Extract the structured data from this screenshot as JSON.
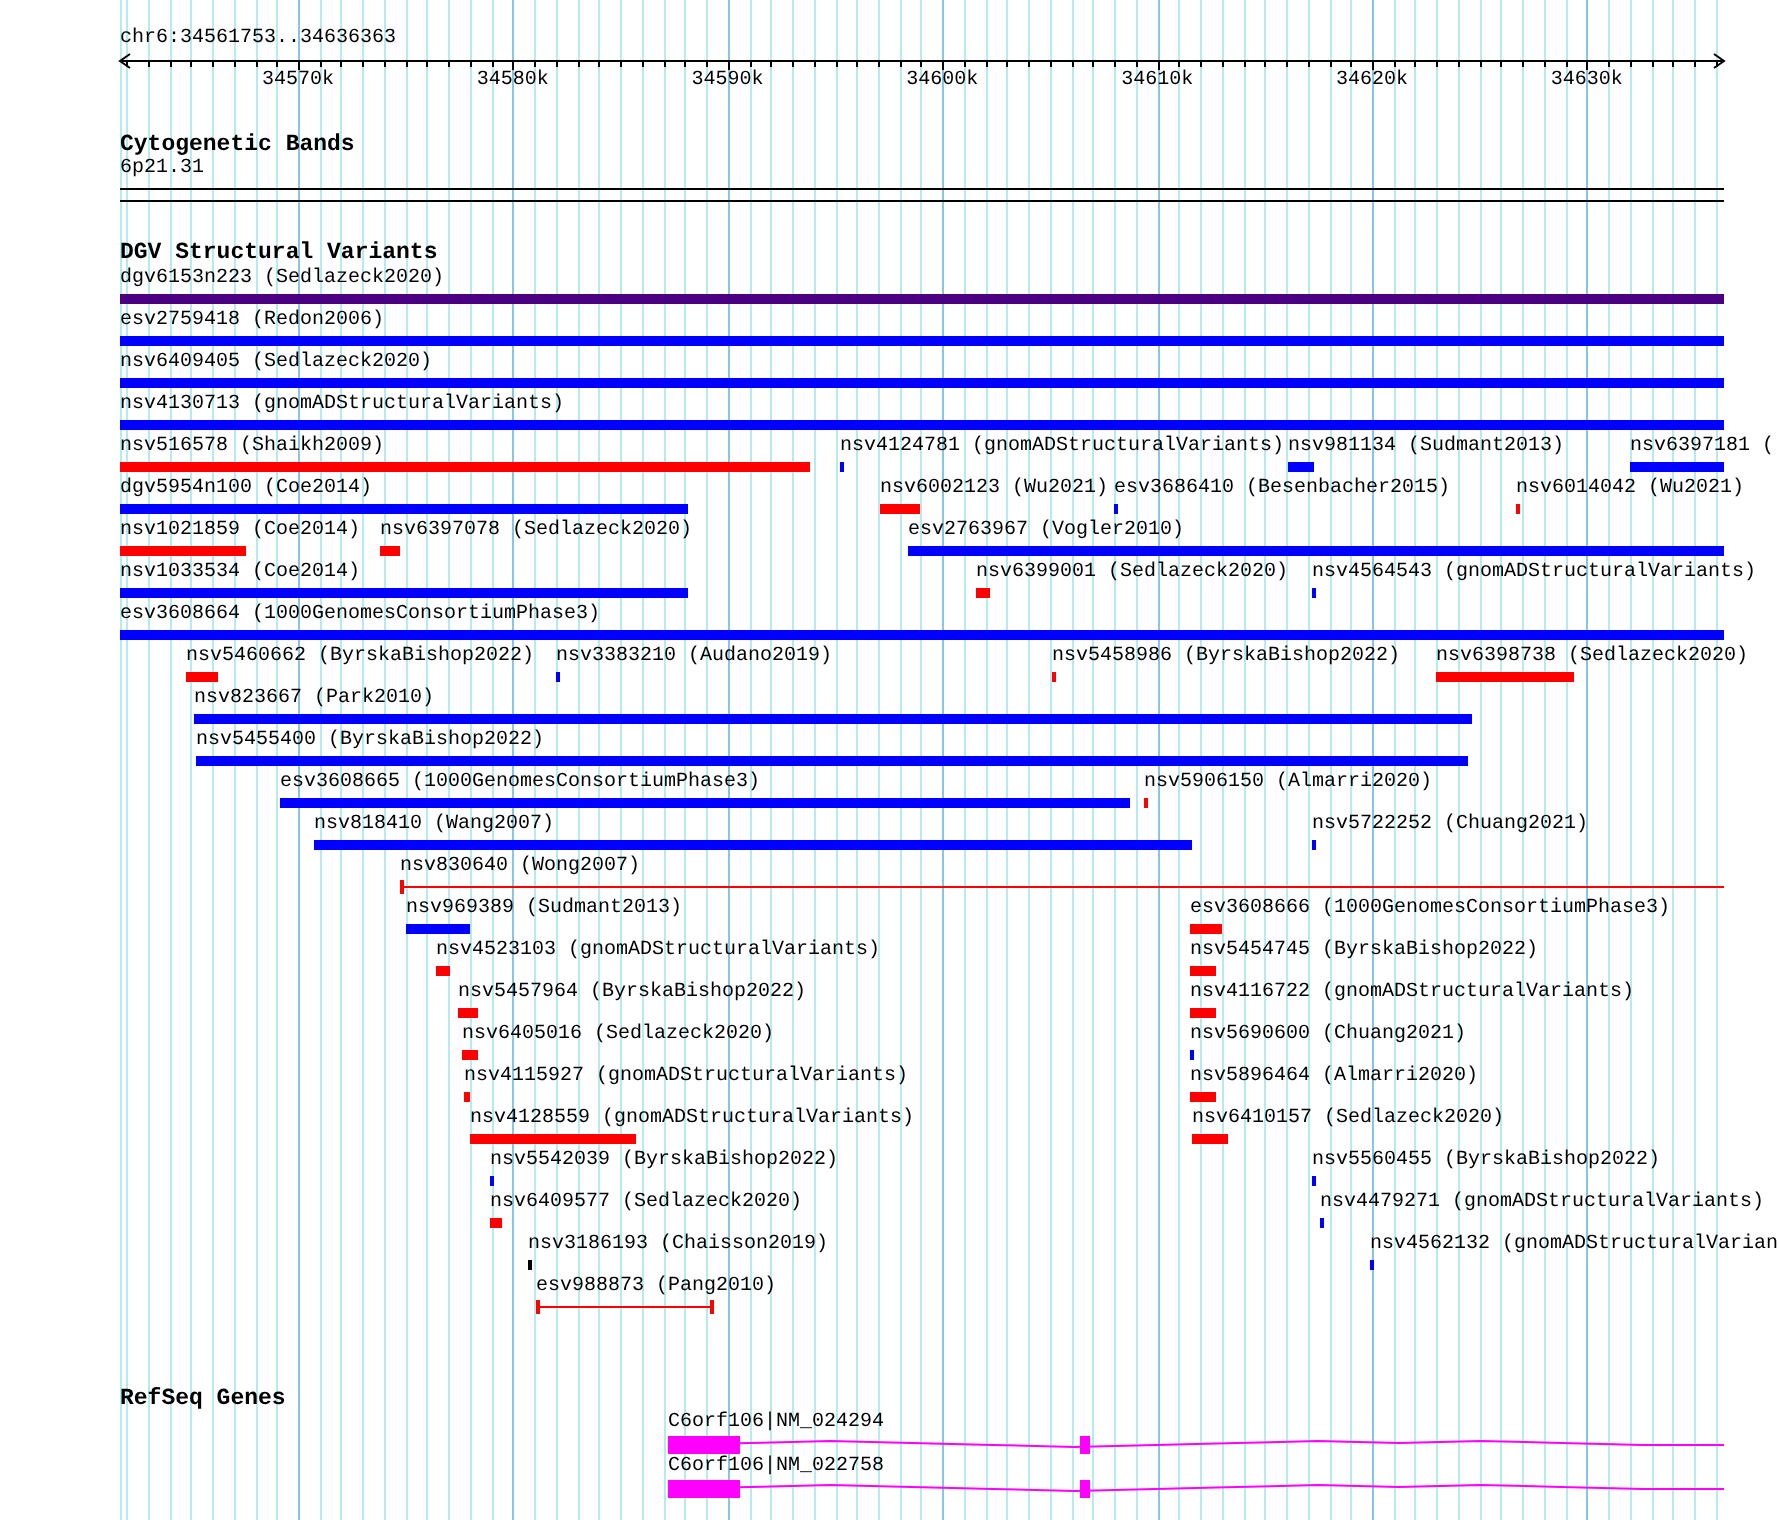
{
  "ruler": {
    "location": "chr6:34561753..34636363",
    "ticks": [
      {
        "label": "34570k"
      },
      {
        "label": "34580k"
      },
      {
        "label": "34590k"
      },
      {
        "label": "34600k"
      },
      {
        "label": "34610k"
      },
      {
        "label": "34620k"
      },
      {
        "label": "34630k"
      }
    ]
  },
  "cytogenetic_bands": {
    "title": "Cytogenetic Bands",
    "band": {
      "label": "6p21.31"
    }
  },
  "dgv_track": {
    "title": "DGV Structural Variants",
    "rows": [
      {
        "features": [
          {
            "label": "dgv6153n223 (Sedlazeck2020)",
            "color": "#4b0082",
            "kind": "bar"
          }
        ]
      },
      {
        "features": [
          {
            "label": "esv2759418 (Redon2006)",
            "color": "#0000ff",
            "kind": "bar"
          }
        ]
      },
      {
        "features": [
          {
            "label": "nsv6409405 (Sedlazeck2020)",
            "color": "#0000ff",
            "kind": "bar"
          }
        ]
      },
      {
        "features": [
          {
            "label": "nsv4130713 (gnomADStructuralVariants)",
            "color": "#0000ff",
            "kind": "bar"
          }
        ]
      },
      {
        "features": [
          {
            "label": "nsv516578 (Shaikh2009)",
            "color": "#ff0000",
            "kind": "bar"
          },
          {
            "label": "nsv4124781 (gnomADStructuralVariants)",
            "color": "#0000ff",
            "kind": "bar"
          },
          {
            "label": "nsv981134 (Sudmant2013)",
            "color": "#0000ff",
            "kind": "bar"
          },
          {
            "label": "nsv6397181 (",
            "color": "#0000ff",
            "kind": "bar"
          }
        ]
      },
      {
        "features": [
          {
            "label": "dgv5954n100 (Coe2014)",
            "color": "#0000ff",
            "kind": "bar"
          },
          {
            "label": "nsv6002123 (Wu2021)",
            "color": "#ff0000",
            "kind": "bar"
          },
          {
            "label": "esv3686410 (Besenbacher2015)",
            "color": "#0000ff",
            "kind": "bar"
          },
          {
            "label": "nsv6014042 (Wu2021)",
            "color": "#ff0000",
            "kind": "bar"
          }
        ]
      },
      {
        "features": [
          {
            "label": "nsv1021859 (Coe2014)",
            "color": "#ff0000",
            "kind": "bar"
          },
          {
            "label": "nsv6397078 (Sedlazeck2020)",
            "color": "#ff0000",
            "kind": "bar"
          },
          {
            "label": "esv2763967 (Vogler2010)",
            "color": "#0000ff",
            "kind": "bar"
          }
        ]
      },
      {
        "features": [
          {
            "label": "nsv1033534 (Coe2014)",
            "color": "#0000ff",
            "kind": "bar"
          },
          {
            "label": "nsv6399001 (Sedlazeck2020)",
            "color": "#ff0000",
            "kind": "bar"
          },
          {
            "label": "nsv4564543 (gnomADStructuralVariants)",
            "color": "#0000ff",
            "kind": "bar"
          }
        ]
      },
      {
        "features": [
          {
            "label": "esv3608664 (1000GenomesConsortiumPhase3)",
            "color": "#0000ff",
            "kind": "bar"
          }
        ]
      },
      {
        "features": [
          {
            "label": "nsv5460662 (ByrskaBishop2022)",
            "color": "#ff0000",
            "kind": "bar"
          },
          {
            "label": "nsv3383210 (Audano2019)",
            "color": "#0000ff",
            "kind": "bar"
          },
          {
            "label": "nsv5458986 (ByrskaBishop2022)",
            "color": "#ff0000",
            "kind": "bar"
          },
          {
            "label": "nsv6398738 (Sedlazeck2020)",
            "color": "#ff0000",
            "kind": "bar"
          }
        ]
      },
      {
        "features": [
          {
            "label": "nsv823667 (Park2010)",
            "color": "#0000ff",
            "kind": "bar"
          }
        ]
      },
      {
        "features": [
          {
            "label": "nsv5455400 (ByrskaBishop2022)",
            "color": "#0000ff",
            "kind": "bar"
          }
        ]
      },
      {
        "features": [
          {
            "label": "esv3608665 (1000GenomesConsortiumPhase3)",
            "color": "#0000ff",
            "kind": "bar"
          },
          {
            "label": "nsv5906150 (Almarri2020)",
            "color": "#ff0000",
            "kind": "bar"
          }
        ]
      },
      {
        "features": [
          {
            "label": "nsv818410 (Wang2007)",
            "color": "#0000ff",
            "kind": "bar"
          },
          {
            "label": "nsv5722252 (Chuang2021)",
            "color": "#0000ff",
            "kind": "bar"
          }
        ]
      },
      {
        "features": [
          {
            "label": "nsv830640 (Wong2007)",
            "color": "#ff0000",
            "kind": "span"
          }
        ]
      },
      {
        "features": [
          {
            "label": "nsv969389 (Sudmant2013)",
            "color": "#0000ff",
            "kind": "bar"
          },
          {
            "label": "esv3608666 (1000GenomesConsortiumPhase3)",
            "color": "#ff0000",
            "kind": "bar"
          }
        ]
      },
      {
        "features": [
          {
            "label": "nsv4523103 (gnomADStructuralVariants)",
            "color": "#ff0000",
            "kind": "bar"
          },
          {
            "label": "nsv5454745 (ByrskaBishop2022)",
            "color": "#ff0000",
            "kind": "bar"
          }
        ]
      },
      {
        "features": [
          {
            "label": "nsv5457964 (ByrskaBishop2022)",
            "color": "#ff0000",
            "kind": "bar"
          },
          {
            "label": "nsv4116722 (gnomADStructuralVariants)",
            "color": "#ff0000",
            "kind": "bar"
          }
        ]
      },
      {
        "features": [
          {
            "label": "nsv6405016 (Sedlazeck2020)",
            "color": "#ff0000",
            "kind": "bar"
          },
          {
            "label": "nsv5690600 (Chuang2021)",
            "color": "#0000ff",
            "kind": "bar"
          }
        ]
      },
      {
        "features": [
          {
            "label": "nsv4115927 (gnomADStructuralVariants)",
            "color": "#ff0000",
            "kind": "bar"
          },
          {
            "label": "nsv5896464 (Almarri2020)",
            "color": "#ff0000",
            "kind": "bar"
          }
        ]
      },
      {
        "features": [
          {
            "label": "nsv4128559 (gnomADStructuralVariants)",
            "color": "#ff0000",
            "kind": "bar"
          },
          {
            "label": "nsv6410157 (Sedlazeck2020)",
            "color": "#ff0000",
            "kind": "bar"
          }
        ]
      },
      {
        "features": [
          {
            "label": "nsv5542039 (ByrskaBishop2022)",
            "color": "#0000ff",
            "kind": "bar"
          },
          {
            "label": "nsv5560455 (ByrskaBishop2022)",
            "color": "#0000ff",
            "kind": "bar"
          }
        ]
      },
      {
        "features": [
          {
            "label": "nsv6409577 (Sedlazeck2020)",
            "color": "#ff0000",
            "kind": "bar"
          },
          {
            "label": "nsv4479271 (gnomADStructuralVariants)",
            "color": "#0000ff",
            "kind": "bar"
          }
        ]
      },
      {
        "features": [
          {
            "label": "nsv3186193 (Chaisson2019)",
            "color": "#000000",
            "kind": "bar"
          },
          {
            "label": "nsv4562132 (gnomADStructuralVarian",
            "color": "#0000ff",
            "kind": "bar"
          }
        ]
      },
      {
        "features": [
          {
            "label": "esv988873 (Pang2010)",
            "color": "#ff0000",
            "kind": "span"
          }
        ]
      }
    ]
  },
  "refseq_track": {
    "title": "RefSeq Genes",
    "genes": [
      {
        "label": "C6orf106|NM_024294"
      },
      {
        "label": "C6orf106|NM_022758"
      }
    ]
  }
}
